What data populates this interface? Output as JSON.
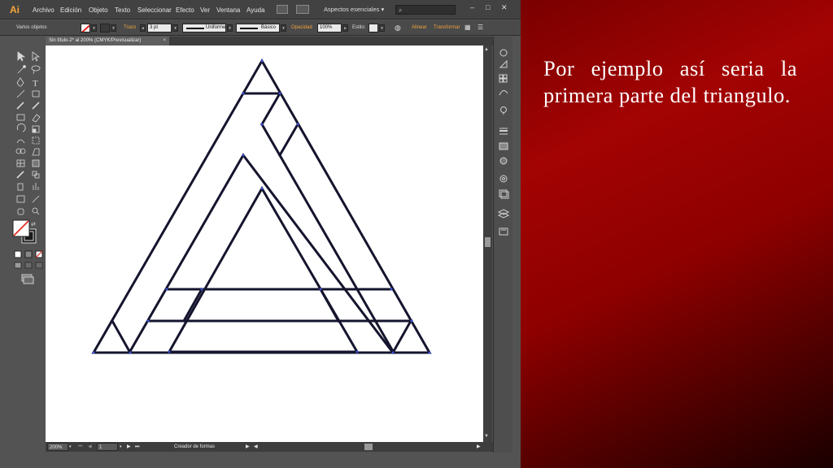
{
  "app": {
    "logo": "Ai",
    "menu": [
      "Archivo",
      "Edición",
      "Objeto",
      "Texto",
      "Seleccionar",
      "Efecto",
      "Ver",
      "Ventana",
      "Ayuda"
    ],
    "workspace": "Aspectos esenciales ▾",
    "window_controls": [
      "–",
      "□",
      "✕"
    ]
  },
  "control_bar": {
    "selection": "Varios objetos",
    "stroke_label": "Trazo",
    "stroke_weight": "3 pt",
    "profile": "Uniforme",
    "brush": "Básico",
    "opacity_label": "Opacidad",
    "opacity_value": "100%",
    "style_label": "Estilo:",
    "align_label": "Alinear",
    "transform_label": "Transformar"
  },
  "document": {
    "tab_title": "Sin título-2* al 200% (CMYK/Previsualizar)",
    "close": "×"
  },
  "status_bar": {
    "zoom": "200%",
    "artboard": "1",
    "tool_name": "Creador de formas"
  },
  "slide": {
    "text": "Por ejemplo así seria la primera parte del triangulo."
  },
  "colors": {
    "ui_dark": "#535353",
    "stroke": "#14142e",
    "accent_orange": "#f0a23c",
    "slide_red": "#a30303"
  },
  "icons": [
    "tool-selection-icon",
    "tool-direct-selection-icon",
    "tool-pen-icon",
    "tool-type-icon",
    "tool-line-icon",
    "tool-rectangle-icon",
    "tool-paintbrush-icon",
    "tool-pencil-icon",
    "tool-rotate-icon",
    "tool-scale-icon",
    "tool-hand-icon",
    "tool-zoom-icon"
  ]
}
